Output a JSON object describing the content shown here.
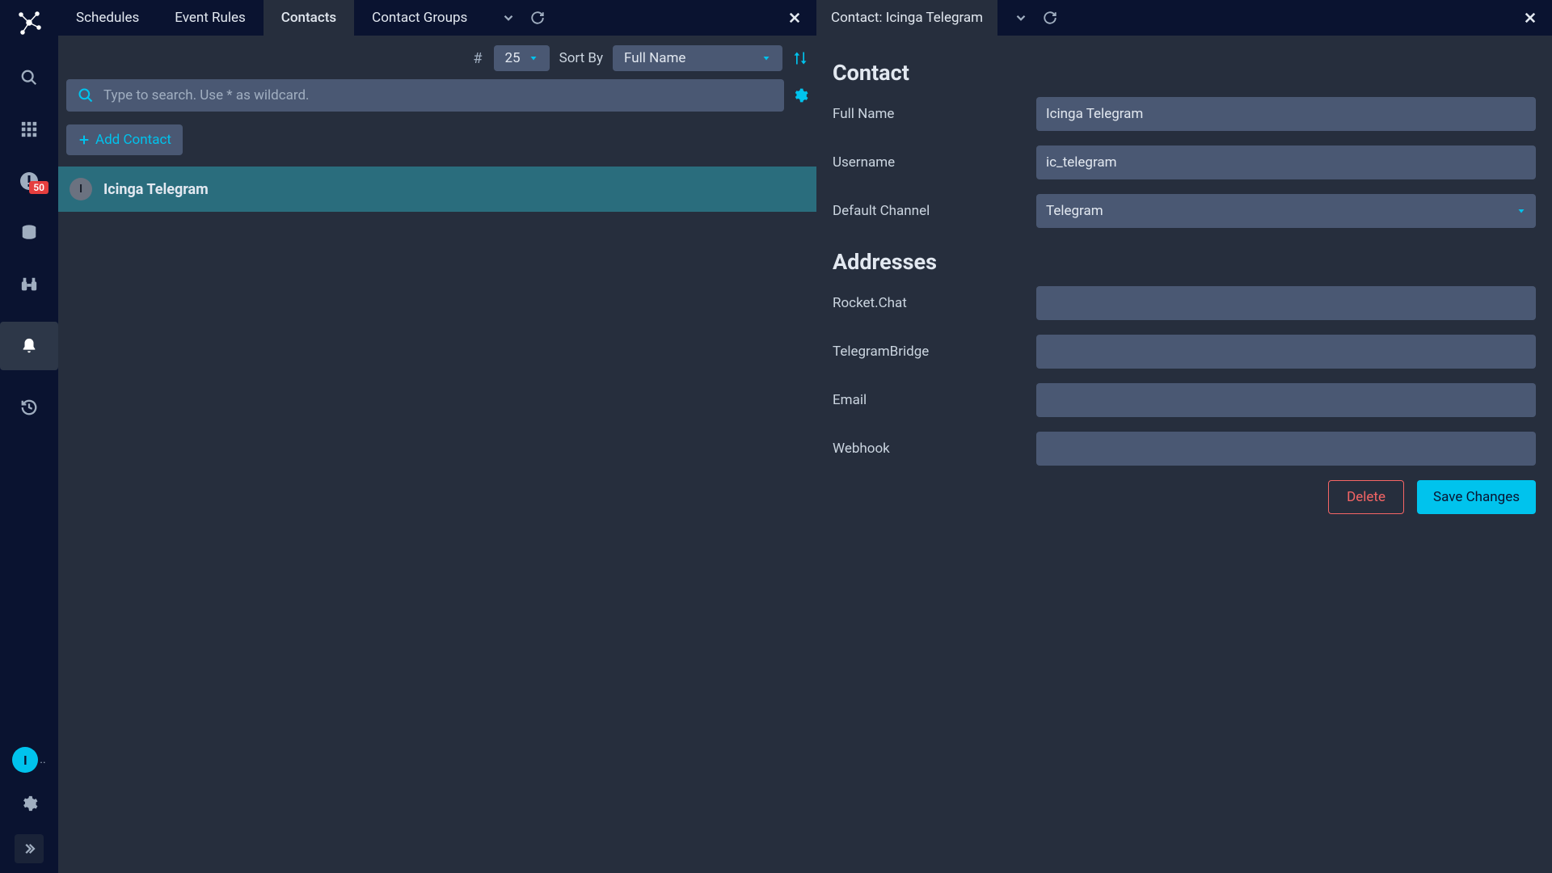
{
  "sidebar": {
    "badge_count": "50",
    "user_initial": "I"
  },
  "tabs": {
    "items": [
      "Schedules",
      "Event Rules",
      "Contacts",
      "Contact Groups"
    ],
    "active_index": 2
  },
  "filters": {
    "hash": "#",
    "page_size": "25",
    "sort_by_label": "Sort By",
    "sort_field": "Full Name"
  },
  "search": {
    "placeholder": "Type to search. Use * as wildcard."
  },
  "add_button": "Add Contact",
  "contacts": [
    {
      "initial": "I",
      "name": "Icinga Telegram"
    }
  ],
  "detail": {
    "header_title": "Contact: Icinga Telegram",
    "sections": {
      "contact": "Contact",
      "addresses": "Addresses"
    },
    "fields": {
      "full_name_label": "Full Name",
      "full_name_value": "Icinga Telegram",
      "username_label": "Username",
      "username_value": "ic_telegram",
      "default_channel_label": "Default Channel",
      "default_channel_value": "Telegram",
      "rocketchat_label": "Rocket.Chat",
      "rocketchat_value": "",
      "telegrambridge_label": "TelegramBridge",
      "telegrambridge_value": "",
      "email_label": "Email",
      "email_value": "",
      "webhook_label": "Webhook",
      "webhook_value": ""
    },
    "buttons": {
      "delete": "Delete",
      "save": "Save Changes"
    }
  }
}
